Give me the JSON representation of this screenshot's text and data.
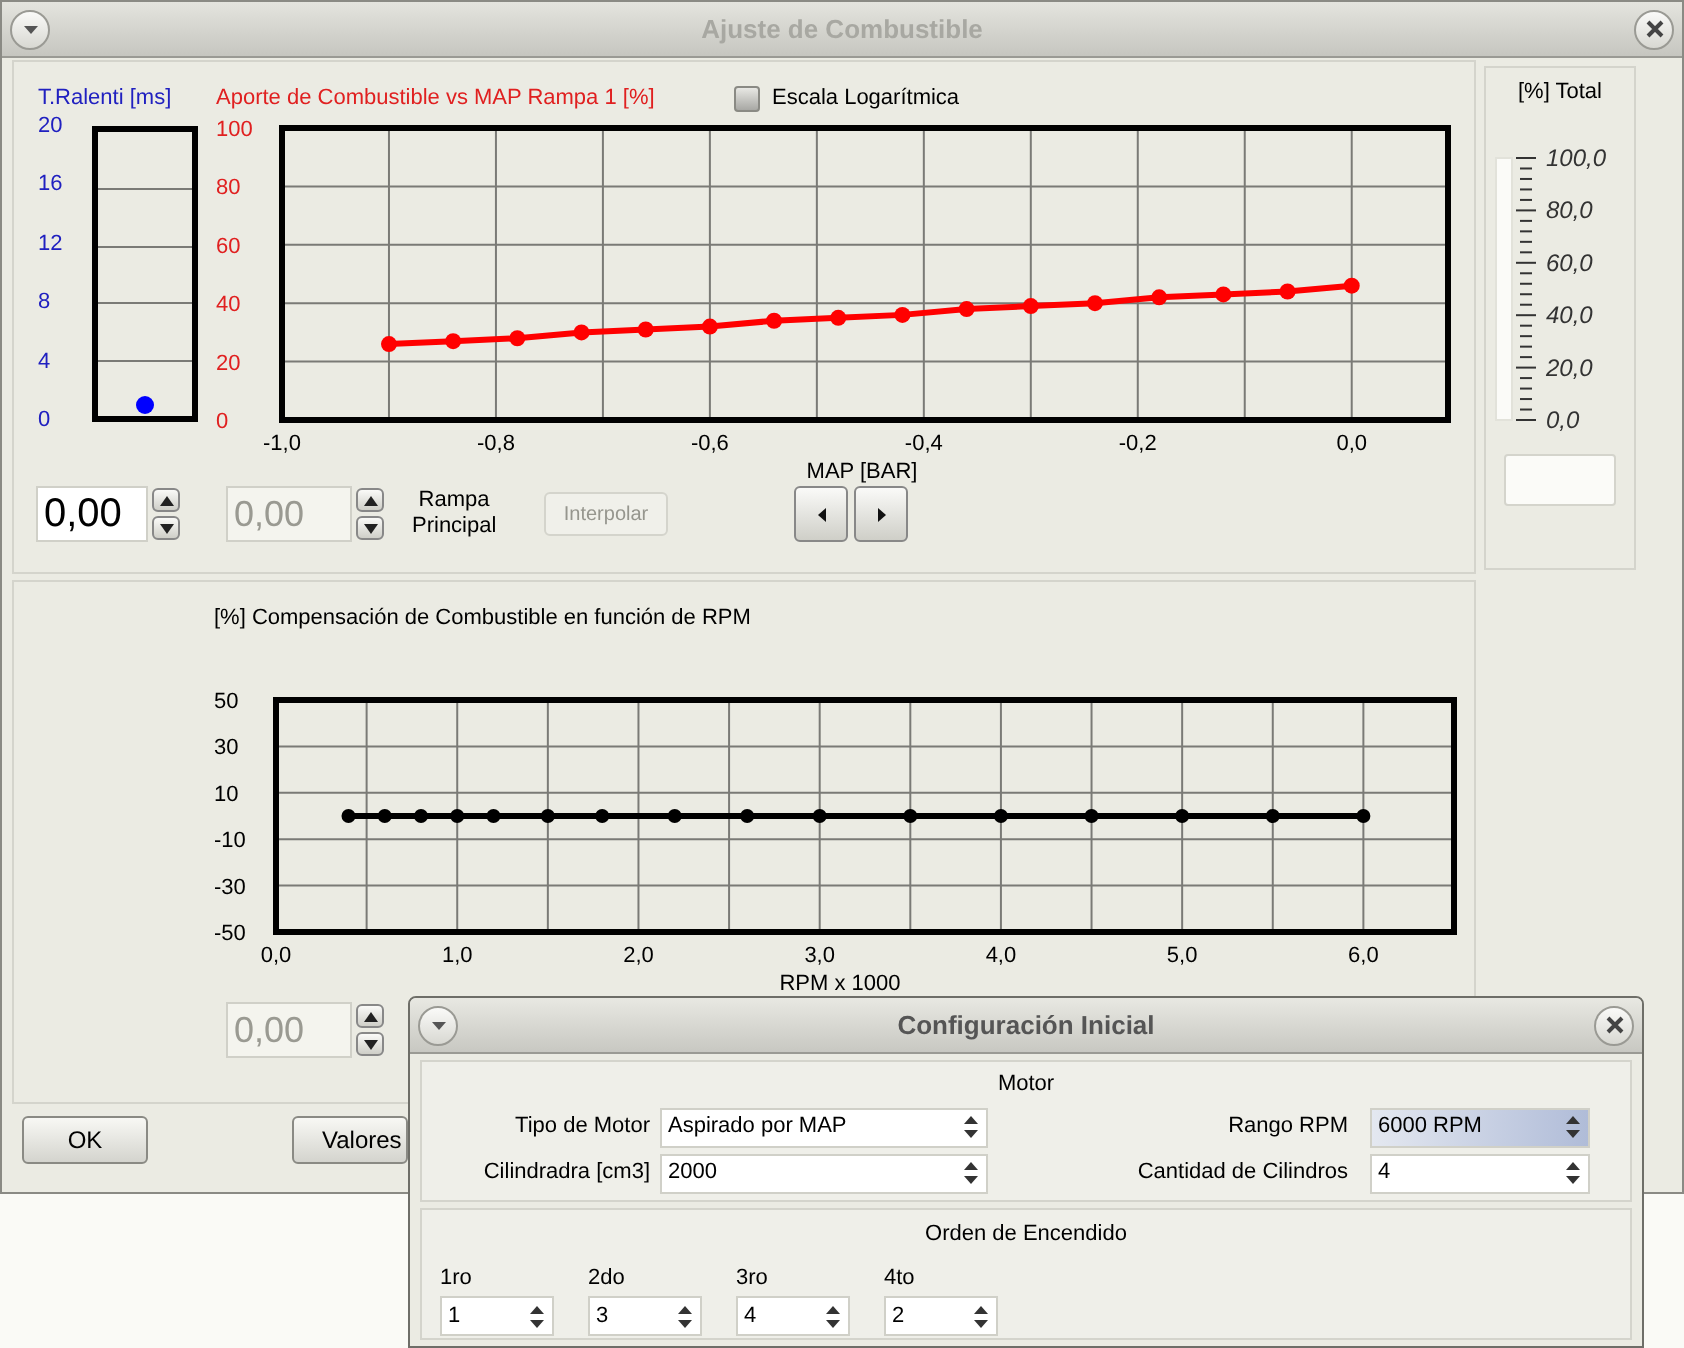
{
  "window": {
    "title": "Ajuste de Combustible"
  },
  "idle_meter": {
    "label": "T.Ralenti [ms]",
    "ticks": [
      "20",
      "16",
      "12",
      "8",
      "4",
      "0"
    ],
    "level": 0.04
  },
  "fuel_chart": {
    "chart_data": {
      "type": "line",
      "title": "Aporte de Combustible vs MAP Rampa 1 [%]",
      "xlabel": "MAP [BAR]",
      "x": [
        -0.9,
        -0.84,
        -0.78,
        -0.72,
        -0.66,
        -0.6,
        -0.54,
        -0.48,
        -0.42,
        -0.36,
        -0.3,
        -0.24,
        -0.18,
        -0.12,
        -0.06,
        0
      ],
      "grid": true,
      "series": [
        {
          "color": "#ff0000",
          "marker": "o",
          "values": [
            26,
            27,
            28,
            30,
            31,
            32,
            34,
            35,
            36,
            38,
            39,
            40,
            42,
            43,
            44,
            46
          ]
        }
      ],
      "xlim": [
        -1,
        0.09
      ],
      "ylim": [
        0,
        100
      ],
      "xticks": [
        {
          "value": -1,
          "label": "-1,0"
        },
        {
          "value": -0.8,
          "label": "-0,8"
        },
        {
          "value": -0.6,
          "label": "-0,6"
        },
        {
          "value": -0.4,
          "label": "-0,4"
        },
        {
          "value": -0.2,
          "label": "-0,2"
        },
        {
          "value": 0,
          "label": "0,0"
        }
      ],
      "yticks": [
        0,
        20,
        40,
        60,
        80,
        100
      ]
    }
  },
  "log_scale": {
    "label": "Escala Logarítmica",
    "checked": false
  },
  "idle_spin": {
    "value": "0,00",
    "disabled": false
  },
  "ramp_spin": {
    "value": "0,00",
    "disabled": true
  },
  "ramp_label": "Rampa Principal",
  "interpolate_button": {
    "label": "Interpolar",
    "disabled": true
  },
  "total_gauge": {
    "label": "[%] Total",
    "ticks": [
      "100,0",
      "80,0",
      "60,0",
      "40,0",
      "20,0",
      "0,0"
    ]
  },
  "rpm_chart": {
    "chart_data": {
      "type": "line",
      "title": "[%] Compensación de Combustible en función de RPM",
      "xlabel": "RPM x 1000",
      "x": [
        0.4,
        0.6,
        0.8,
        1.0,
        1.2,
        1.5,
        1.8,
        2.2,
        2.6,
        3.0,
        3.5,
        4.0,
        4.5,
        5.0,
        5.5,
        6.0
      ],
      "grid": true,
      "series": [
        {
          "color": "#000000",
          "marker": "o",
          "values": [
            0,
            0,
            0,
            0,
            0,
            0,
            0,
            0,
            0,
            0,
            0,
            0,
            0,
            0,
            0,
            0
          ]
        }
      ],
      "xlim": [
        0,
        6.5
      ],
      "ylim": [
        -50,
        50
      ],
      "xticks": [
        {
          "value": 0,
          "label": "0,0"
        },
        {
          "value": 1,
          "label": "1,0"
        },
        {
          "value": 2,
          "label": "2,0"
        },
        {
          "value": 3,
          "label": "3,0"
        },
        {
          "value": 4,
          "label": "4,0"
        },
        {
          "value": 5,
          "label": "5,0"
        },
        {
          "value": 6,
          "label": "6,0"
        }
      ],
      "yticks": [
        -50,
        -30,
        -10,
        10,
        30,
        50
      ]
    }
  },
  "rpm_spin": {
    "value": "0,00",
    "disabled": true
  },
  "buttons": [
    {
      "label": "OK"
    },
    {
      "label": "Valores"
    }
  ],
  "dialog": {
    "title": "Configuración Inicial",
    "motor": {
      "title": "Motor",
      "fields": [
        {
          "label": "Tipo de Motor",
          "value": "Aspirado por MAP",
          "focused": false
        },
        {
          "label": "Rango RPM",
          "value": "6000 RPM",
          "focused": true
        },
        {
          "label": "Cilindradra [cm3]",
          "value": "2000",
          "focused": false
        },
        {
          "label": "Cantidad de Cilindros",
          "value": "4",
          "focused": false
        }
      ]
    },
    "firing_order": {
      "title": "Orden de Encendido",
      "fields": [
        {
          "label": "1ro",
          "value": "1"
        },
        {
          "label": "2do",
          "value": "3"
        },
        {
          "label": "3ro",
          "value": "4"
        },
        {
          "label": "4to",
          "value": "2"
        }
      ]
    }
  }
}
